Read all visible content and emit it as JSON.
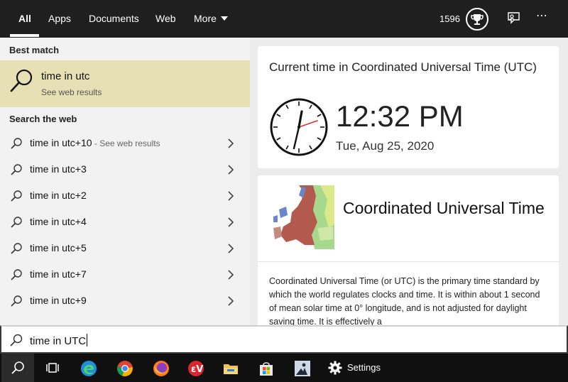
{
  "tabs": [
    {
      "label": "All",
      "active": true
    },
    {
      "label": "Apps"
    },
    {
      "label": "Documents"
    },
    {
      "label": "Web"
    },
    {
      "label": "More"
    }
  ],
  "header": {
    "points": "1596",
    "icons": [
      "trophy-icon",
      "feedback-icon",
      "more-options-icon"
    ]
  },
  "left": {
    "best_match_heading": "Best match",
    "best_match": {
      "title": "time in utc",
      "subtitle": "See web results"
    },
    "web_heading": "Search the web",
    "results": [
      {
        "text": "time in utc+10",
        "suffix": " - See web results"
      },
      {
        "text": "time in utc+3"
      },
      {
        "text": "time in utc+2"
      },
      {
        "text": "time in utc+4"
      },
      {
        "text": "time in utc+5"
      },
      {
        "text": "time in utc+7"
      },
      {
        "text": "time in utc+9"
      }
    ]
  },
  "right": {
    "time_card": {
      "title": "Current time in Coordinated Universal Time (UTC)",
      "time": "12:32 PM",
      "date": "Tue, Aug 25, 2020"
    },
    "info_card": {
      "title": "Coordinated Universal Time",
      "description": "Coordinated Universal Time (or UTC) is the primary time standard by which the world regulates clocks and time. It is within about 1 second of mean solar time at 0° longitude, and is not adjusted for daylight saving time. It is effectively a"
    }
  },
  "search": {
    "value": "time in UTC"
  },
  "taskbar": {
    "items": [
      "search-icon",
      "task-view-icon",
      "edge-icon",
      "chrome-icon",
      "firefox-icon",
      "expressvpn-icon",
      "file-explorer-icon",
      "store-icon",
      "kindle-icon"
    ],
    "settings_label": "Settings"
  },
  "colors": {
    "best_match_bg": "#e7e0b4",
    "topbar_bg": "#1f1f1f",
    "taskbar_bg": "#101010",
    "clock_second_hand": "#e0302c"
  }
}
